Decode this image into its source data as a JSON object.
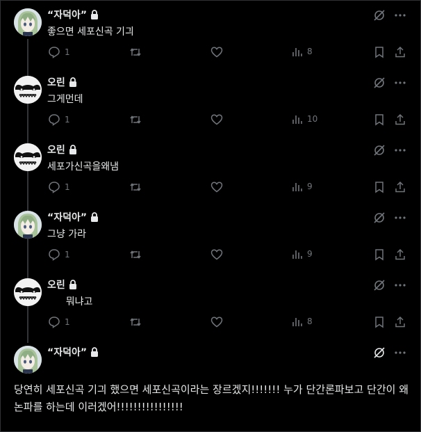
{
  "tweets": [
    {
      "author": "“자덕아”",
      "avatar": "anime-girl",
      "text": "좋으면 세포신곡 기긔",
      "replies": "1",
      "views": "8"
    },
    {
      "author": "오린",
      "avatar": "white-face",
      "text": "그게먼데",
      "replies": "1",
      "views": "10"
    },
    {
      "author": "오린",
      "avatar": "white-face",
      "text": "세포가신곡을왜냄",
      "replies": "1",
      "views": "9"
    },
    {
      "author": "“자덕아”",
      "avatar": "anime-girl",
      "text": "그냥 가라",
      "replies": "1",
      "views": "9"
    },
    {
      "author": "오린",
      "avatar": "white-face",
      "text": "      뭐냐고",
      "replies": "1",
      "views": "8"
    }
  ],
  "focused": {
    "author": "“자덕아”",
    "text": "        당연히 세포신곡 기긔 했으면 세포신곡이라는 장르겠지!!!!!!! 누가 단간론파보고 단간이 왜 논파를 하는데          이러겠어!!!!!!!!!!!!!!!!"
  },
  "icons": [
    "lock-icon",
    "grok-icon",
    "more-icon",
    "reply-icon",
    "retweet-icon",
    "like-icon",
    "views-icon",
    "bookmark-icon",
    "share-icon"
  ],
  "colors": {
    "background": "#000000",
    "text": "#e7e9ea",
    "muted": "#71767b",
    "line": "#333639"
  }
}
